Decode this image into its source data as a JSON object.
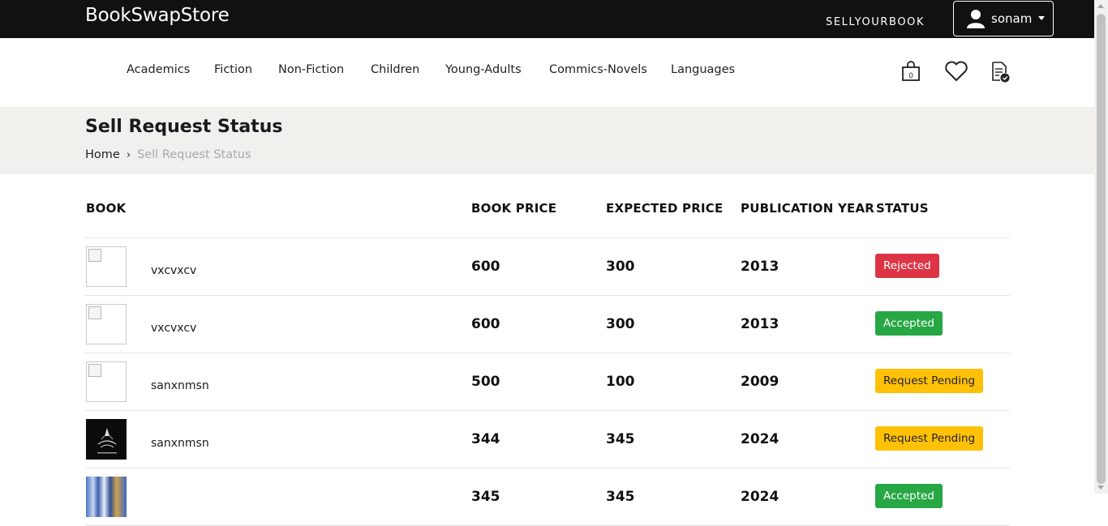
{
  "header": {
    "brand": "BookSwapStore",
    "sell_link": "SELLYOURBOOK",
    "user_name": "sonam"
  },
  "categories": [
    "Academics",
    "Fiction",
    "Non-Fiction",
    "Children",
    "Young-Adults",
    "Commics-Novels",
    "Languages"
  ],
  "nav_icons": {
    "cart_count": "0",
    "cart_icon": "shopping-bag-icon",
    "wishlist_icon": "heart-icon",
    "orders_icon": "document-check-icon"
  },
  "page": {
    "title": "Sell Request Status",
    "breadcrumb_home": "Home",
    "breadcrumb_current": "Sell Request Status"
  },
  "table": {
    "headers": {
      "book": "BOOK",
      "book_price": "BOOK PRICE",
      "expected_price": "EXPECTED PRICE",
      "publication_year": "PUBLICATION YEAR",
      "status": "STATUS"
    },
    "rows": [
      {
        "name": "vxcvxcv",
        "book_price": "600",
        "expected_price": "300",
        "year": "2013",
        "status": "Rejected",
        "thumb": "broken"
      },
      {
        "name": "vxcvxcv",
        "book_price": "600",
        "expected_price": "300",
        "year": "2013",
        "status": "Accepted",
        "thumb": "broken"
      },
      {
        "name": "sanxnmsn",
        "book_price": "500",
        "expected_price": "100",
        "year": "2009",
        "status": "Request Pending",
        "thumb": "broken"
      },
      {
        "name": "sanxnmsn",
        "book_price": "344",
        "expected_price": "345",
        "year": "2024",
        "status": "Request Pending",
        "thumb": "dark-logo"
      },
      {
        "name": "",
        "book_price": "345",
        "expected_price": "345",
        "year": "2024",
        "status": "Accepted",
        "thumb": "art"
      }
    ]
  },
  "colors": {
    "topbar": "#111111",
    "band": "#f1f0ed",
    "rejected": "#dc3545",
    "accepted": "#28a745",
    "pending": "#ffc107"
  }
}
